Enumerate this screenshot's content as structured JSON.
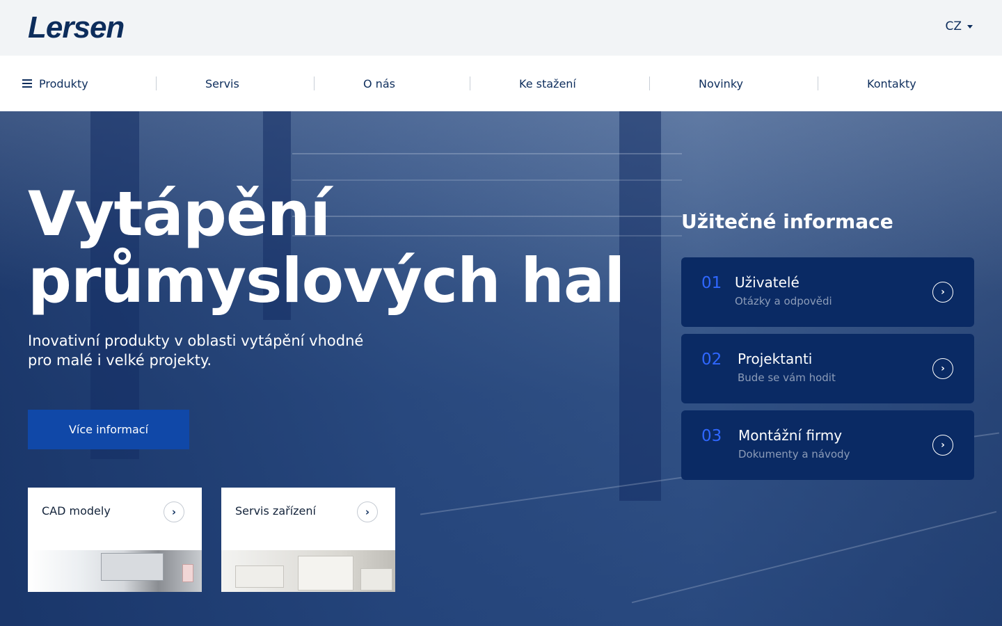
{
  "header": {
    "logo_text": "Lersen",
    "language": "CZ"
  },
  "nav": {
    "items": [
      {
        "label": "Produkty"
      },
      {
        "label": "Servis"
      },
      {
        "label": "O nás"
      },
      {
        "label": "Ke stažení"
      },
      {
        "label": "Novinky"
      },
      {
        "label": "Kontakty"
      }
    ]
  },
  "hero": {
    "title_line1": "Vytápění",
    "title_line2": "průmyslových hal",
    "lead_line1": "Inovativní produkty v oblasti vytápění vhodné",
    "lead_line2": "pro malé i velké projekty.",
    "cta_label": "Více informací"
  },
  "cards": [
    {
      "title": "CAD modely",
      "arrow": "›"
    },
    {
      "title": "Servis zařízení",
      "arrow": "›"
    }
  ],
  "useful_info": {
    "title": "Užitečné informace",
    "items": [
      {
        "num": "01",
        "label": "Uživatelé",
        "sub": "Otázky a odpovědi",
        "arrow": "›"
      },
      {
        "num": "02",
        "label": "Projektanti",
        "sub": "Bude se vám hodit",
        "arrow": "›"
      },
      {
        "num": "03",
        "label": "Montážní firmy",
        "sub": "Dokumenty a návody",
        "arrow": "›"
      }
    ]
  },
  "colors": {
    "brand_navy": "#0d2d5c",
    "cta_blue": "#1048a8",
    "info_card_bg": "#0a2a64",
    "info_number": "#2f67ff"
  }
}
